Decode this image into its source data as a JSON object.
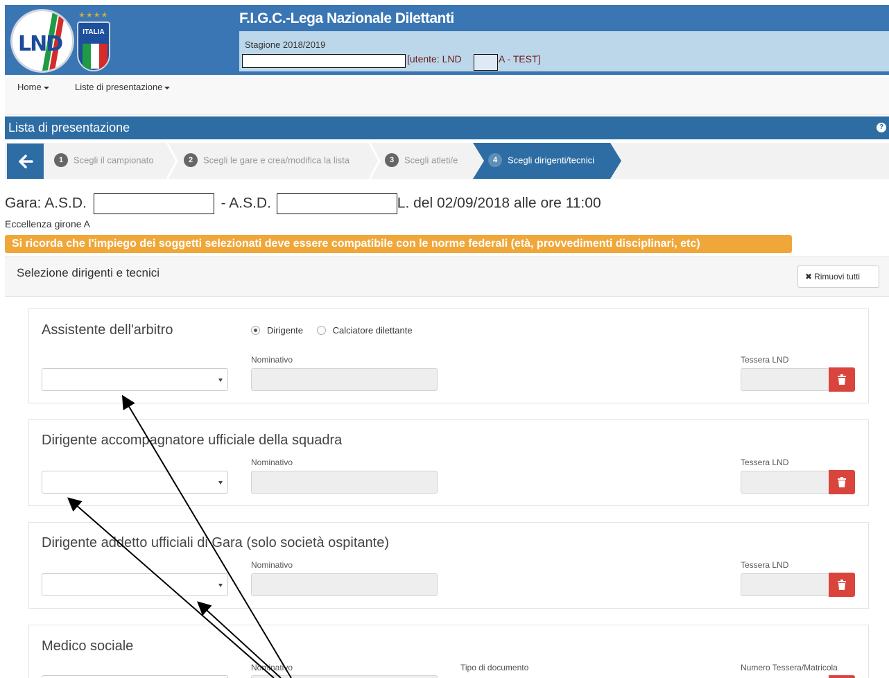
{
  "header": {
    "org_title": "F.I.G.C.-Lega Nazionale Dilettanti",
    "season": "Stagione 2018/2019",
    "user_prefix": "[utente: LND",
    "user_suffix": "A - TEST]",
    "logo_lnd_text": "LND",
    "logo_italia_text": "ITALIA"
  },
  "nav": {
    "home": "Home",
    "liste": "Liste di presentazione"
  },
  "page_title": "Lista di presentazione",
  "wizard": {
    "steps": [
      {
        "num": "1",
        "label": "Scegli il campionato"
      },
      {
        "num": "2",
        "label": "Scegli le gare e crea/modifica la lista"
      },
      {
        "num": "3",
        "label": "Scegli atleti/e"
      },
      {
        "num": "4",
        "label": "Scegli dirigenti/tecnici"
      }
    ]
  },
  "match": {
    "gara_prefix": "Gara: A.S.D.",
    "gara_mid": "- A.S.D.",
    "gara_suffix": "L. del 02/09/2018 alle ore 11:00",
    "girone": "Eccellenza girone A"
  },
  "warning": "Si ricorda che l'impiego dei soggetti selezionati deve essere compatibile con le norme federali (età, provvedimenti disciplinari, etc)",
  "panel": {
    "title": "Selezione dirigenti e tecnici",
    "remove_all": "Rimuovi tutti"
  },
  "sections": [
    {
      "title": "Assistente dell'arbitro",
      "radio_1": "Dirigente",
      "radio_2": "Calciatore dilettante",
      "nominativo_label": "Nominativo",
      "tessera_label": "Tessera LND"
    },
    {
      "title": "Dirigente accompagnatore ufficiale della squadra",
      "nominativo_label": "Nominativo",
      "tessera_label": "Tessera LND"
    },
    {
      "title": "Dirigente addetto ufficiali di Gara (solo società ospitante)",
      "nominativo_label": "Nominativo",
      "tessera_label": "Tessera LND"
    },
    {
      "title": "Medico sociale",
      "nominativo_label": "Nominativo",
      "tipo_doc_label": "Tipo di documento",
      "tessera_label": "Numero Tessera/Matricola"
    }
  ],
  "colors": {
    "header_blue": "#3a76b3",
    "title_bar": "#2e6da4",
    "info_box": "#bcd7ea",
    "warning_orange": "#f0a73a",
    "trash_red": "#d9453d"
  }
}
